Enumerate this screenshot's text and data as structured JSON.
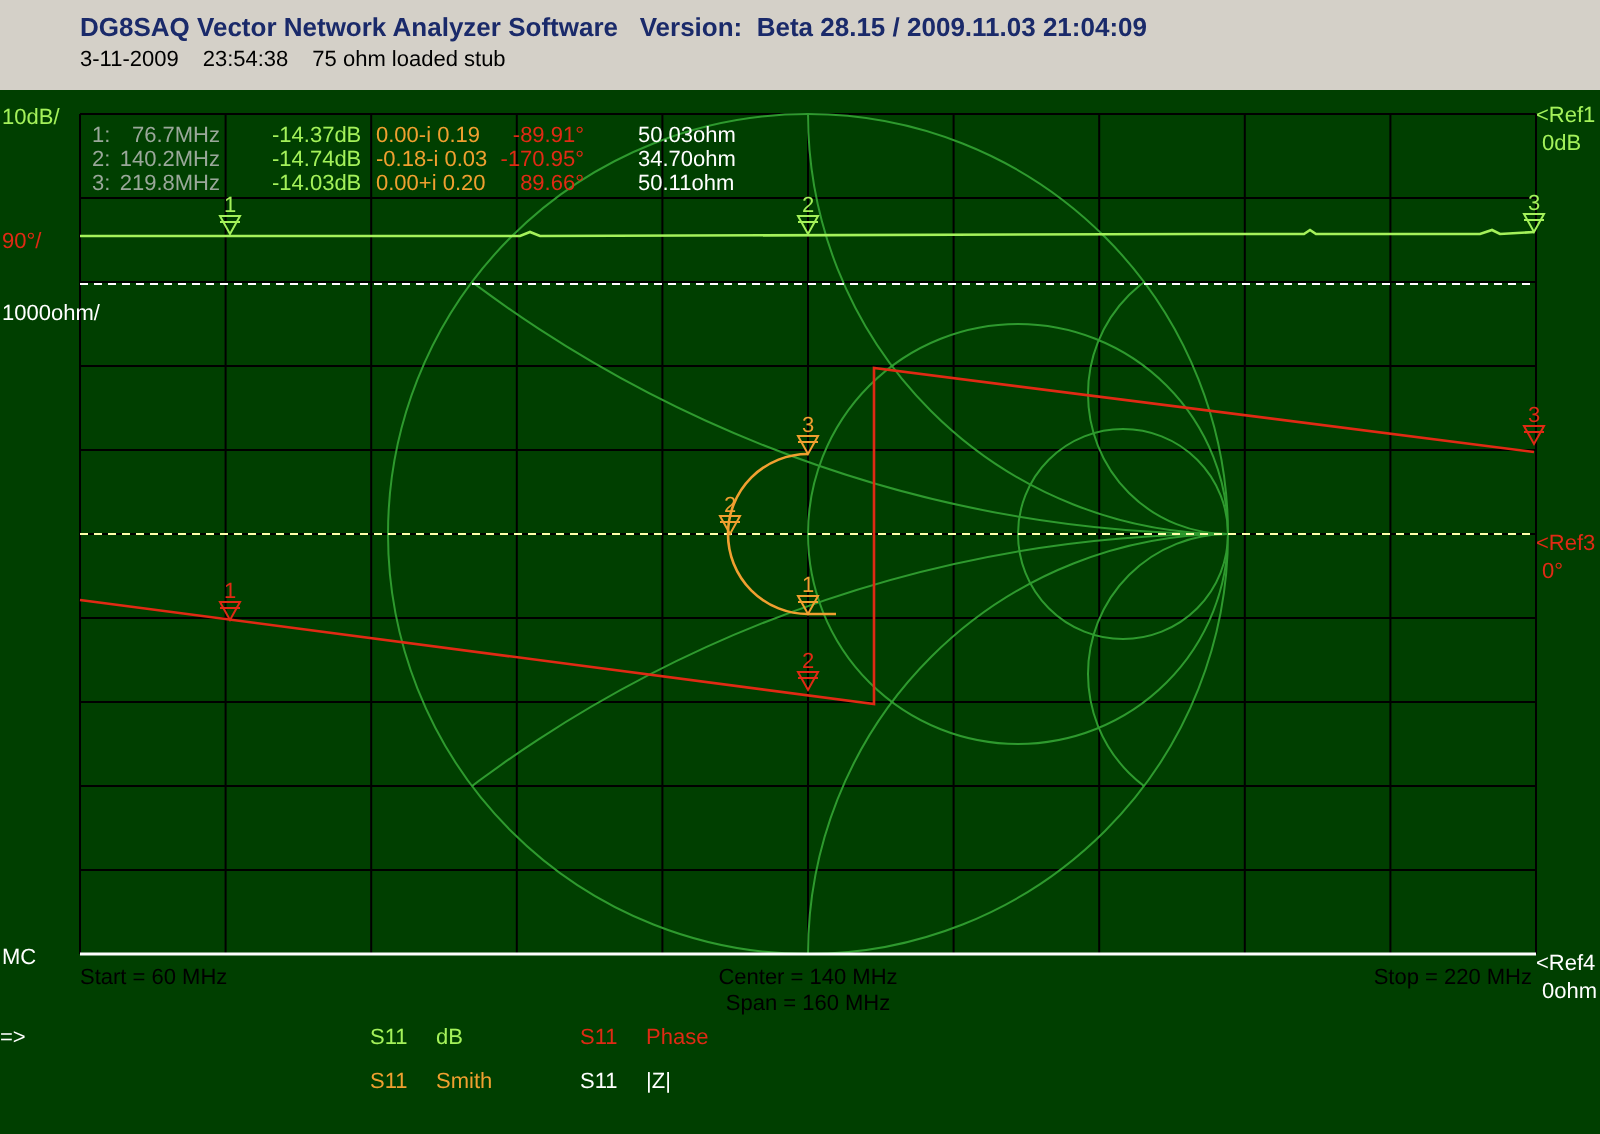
{
  "window": {
    "title": "DG8SAQ Vector Network Analyzer Software   Version:  Beta 28.15 / 2009.11.03 21:04:09"
  },
  "subtitle": {
    "date": "3-11-2009",
    "time": "23:54:38",
    "description": "75 ohm loaded stub"
  },
  "plot": {
    "scale_labels": [
      {
        "text": "10dB/",
        "kind": "db"
      },
      {
        "text": "90°/",
        "kind": "phase"
      },
      {
        "text": "1000ohm/",
        "kind": "impedance"
      },
      {
        "text": "MC",
        "kind": "impedance"
      }
    ],
    "ref_labels": [
      {
        "name": "<Ref1",
        "value": "0dB",
        "kind": "db"
      },
      {
        "name": "<Ref3",
        "value": "0°",
        "kind": "phase"
      },
      {
        "name": "<Ref4",
        "value": "0ohm",
        "kind": "impedance"
      }
    ],
    "marker_readouts": [
      {
        "marker": "1:",
        "frequency": "76.7MHz",
        "db": "-14.37dB",
        "complex": "0.00-i 0.19",
        "phase": "-89.91°",
        "impedance": "50.03ohm"
      },
      {
        "marker": "2:",
        "frequency": "140.2MHz",
        "db": "-14.74dB",
        "complex": "-0.18-i 0.03",
        "phase": "-170.95°",
        "impedance": "34.70ohm"
      },
      {
        "marker": "3:",
        "frequency": "219.8MHz",
        "db": "-14.03dB",
        "complex": "0.00+i 0.20",
        "phase": "89.66°",
        "impedance": "50.11ohm"
      }
    ],
    "traces": [
      {
        "kind": "db",
        "markers": [
          "1",
          "2",
          "3"
        ]
      },
      {
        "kind": "phase",
        "markers": [
          "1",
          "2",
          "3"
        ]
      },
      {
        "kind": "smith",
        "markers": [
          "1",
          "2",
          "3"
        ]
      }
    ],
    "frequency_axis": {
      "start": "Start = 60 MHz",
      "center": "Center = 140 MHz",
      "span": "Span = 160 MHz",
      "stop": "Stop = 220 MHz"
    }
  },
  "pointer": "=>",
  "legend": [
    {
      "parameter": "S11",
      "format": "dB",
      "kind": "db"
    },
    {
      "parameter": "S11",
      "format": "Phase",
      "kind": "phase"
    },
    {
      "parameter": "S11",
      "format": "Smith",
      "kind": "smith"
    },
    {
      "parameter": "S11",
      "format": "|Z|",
      "kind": "impedance"
    }
  ]
}
